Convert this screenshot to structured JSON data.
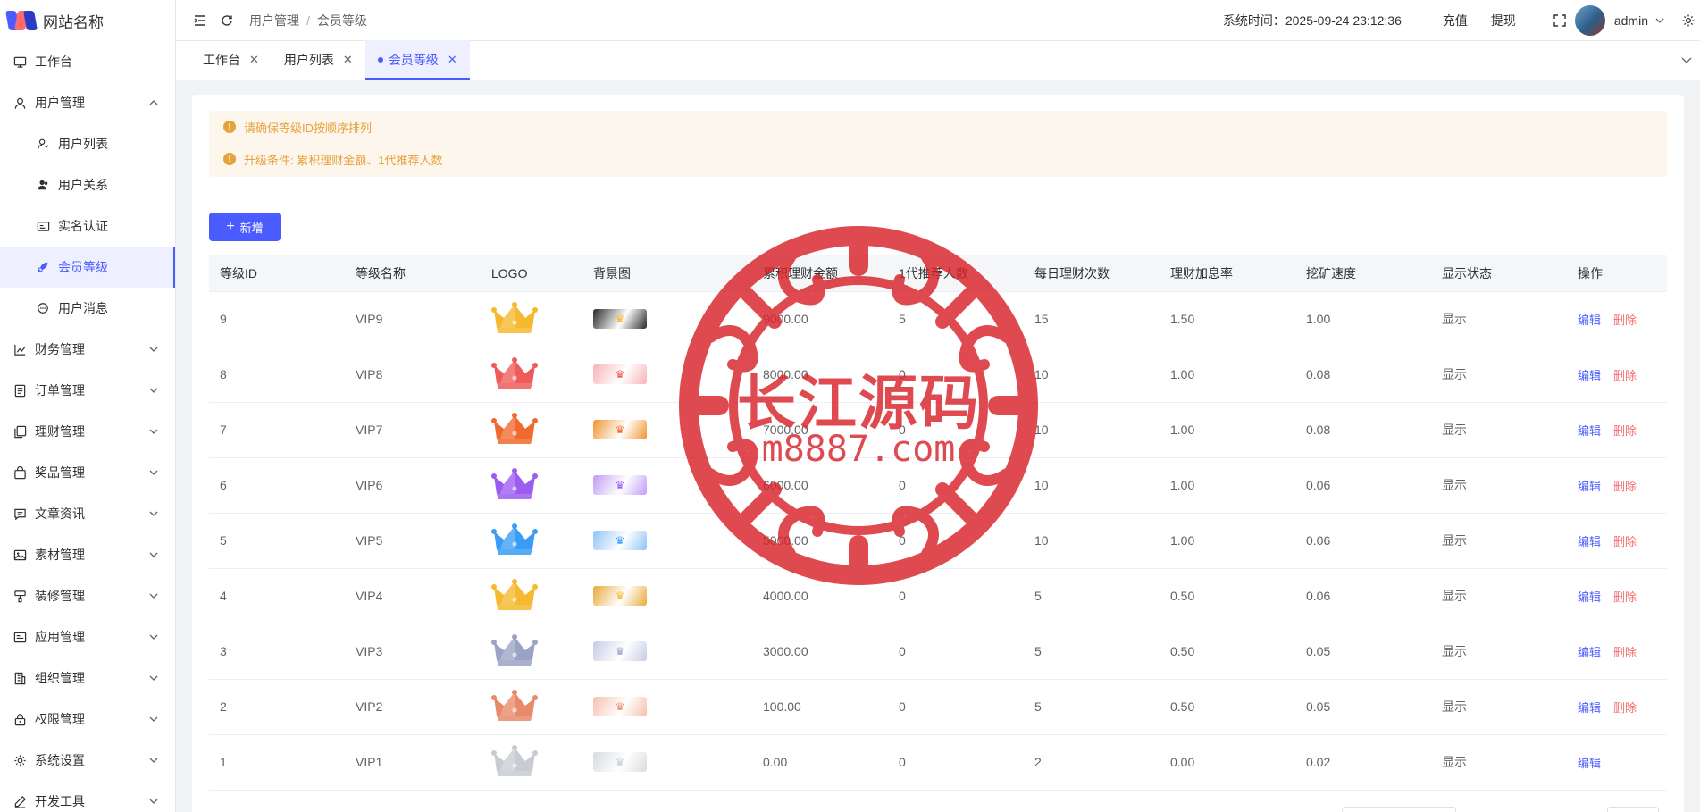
{
  "brand": {
    "name": "网站名称"
  },
  "sidebar": {
    "items": [
      {
        "label": "工作台",
        "icon": "monitor-icon"
      },
      {
        "label": "用户管理",
        "icon": "user-icon",
        "expanded": true,
        "children": [
          {
            "label": "用户列表",
            "icon": "user-outline-icon"
          },
          {
            "label": "用户关系",
            "icon": "user-filled-icon"
          },
          {
            "label": "实名认证",
            "icon": "id-card-icon"
          },
          {
            "label": "会员等级",
            "icon": "rocket-icon",
            "active": true
          },
          {
            "label": "用户消息",
            "icon": "chat-icon"
          }
        ]
      },
      {
        "label": "财务管理",
        "icon": "chart-icon"
      },
      {
        "label": "订单管理",
        "icon": "document-icon"
      },
      {
        "label": "理财管理",
        "icon": "copy-icon"
      },
      {
        "label": "奖品管理",
        "icon": "bag-icon"
      },
      {
        "label": "文章资讯",
        "icon": "message-icon"
      },
      {
        "label": "素材管理",
        "icon": "picture-icon"
      },
      {
        "label": "装修管理",
        "icon": "brush-icon"
      },
      {
        "label": "应用管理",
        "icon": "app-icon"
      },
      {
        "label": "组织管理",
        "icon": "building-icon"
      },
      {
        "label": "权限管理",
        "icon": "lock-icon"
      },
      {
        "label": "系统设置",
        "icon": "gear-icon"
      },
      {
        "label": "开发工具",
        "icon": "pen-icon"
      }
    ]
  },
  "header": {
    "breadcrumb": [
      "用户管理",
      "会员等级"
    ],
    "system_time": "系统时间：2025-09-24 23:12:36",
    "recharge": "充值",
    "withdraw": "提现",
    "user": "admin"
  },
  "tabs": [
    {
      "label": "工作台"
    },
    {
      "label": "用户列表"
    },
    {
      "label": "会员等级",
      "active": true
    }
  ],
  "alerts": [
    "请确保等级ID按顺序排列",
    "升级条件: 累积理财金额、1代推荐人数"
  ],
  "toolbar": {
    "add_label": "新增"
  },
  "table": {
    "columns": [
      "等级ID",
      "等级名称",
      "LOGO",
      "背景图",
      "累积理财金额",
      "1代推荐人数",
      "每日理财次数",
      "理财加息率",
      "挖矿速度",
      "显示状态",
      "操作"
    ],
    "edit_label": "编辑",
    "delete_label": "删除",
    "rows": [
      {
        "id": "9",
        "name": "VIP9",
        "amount": "9000.00",
        "referrals": "5",
        "daily": "15",
        "rate": "1.50",
        "speed": "1.00",
        "status": "显示",
        "crown_color": "#f5b82e",
        "bg_color": "#2a2a2a",
        "deletable": true
      },
      {
        "id": "8",
        "name": "VIP8",
        "amount": "8000.00",
        "referrals": "0",
        "daily": "10",
        "rate": "1.00",
        "speed": "0.08",
        "status": "显示",
        "crown_color": "#ef5a5a",
        "bg_color": "#f7b3b8",
        "deletable": true
      },
      {
        "id": "7",
        "name": "VIP7",
        "amount": "7000.00",
        "referrals": "0",
        "daily": "10",
        "rate": "1.00",
        "speed": "0.08",
        "status": "显示",
        "crown_color": "#f06a2e",
        "bg_color": "#f0942f",
        "deletable": true
      },
      {
        "id": "6",
        "name": "VIP6",
        "amount": "6000.00",
        "referrals": "0",
        "daily": "10",
        "rate": "1.00",
        "speed": "0.06",
        "status": "显示",
        "crown_color": "#9b5cf0",
        "bg_color": "#c19cf5",
        "deletable": true
      },
      {
        "id": "5",
        "name": "VIP5",
        "amount": "5000.00",
        "referrals": "0",
        "daily": "10",
        "rate": "1.00",
        "speed": "0.06",
        "status": "显示",
        "crown_color": "#3a9df5",
        "bg_color": "#8fc2f7",
        "deletable": true
      },
      {
        "id": "4",
        "name": "VIP4",
        "amount": "4000.00",
        "referrals": "0",
        "daily": "5",
        "rate": "0.50",
        "speed": "0.06",
        "status": "显示",
        "crown_color": "#f5b82e",
        "bg_color": "#e9a93a",
        "deletable": true
      },
      {
        "id": "3",
        "name": "VIP3",
        "amount": "3000.00",
        "referrals": "0",
        "daily": "5",
        "rate": "0.50",
        "speed": "0.05",
        "status": "显示",
        "crown_color": "#9aa3c4",
        "bg_color": "#c5cbe6",
        "deletable": true
      },
      {
        "id": "2",
        "name": "VIP2",
        "amount": "100.00",
        "referrals": "0",
        "daily": "5",
        "rate": "0.50",
        "speed": "0.05",
        "status": "显示",
        "crown_color": "#e88a6a",
        "bg_color": "#f6c0ae",
        "deletable": true
      },
      {
        "id": "1",
        "name": "VIP1",
        "amount": "0.00",
        "referrals": "0",
        "daily": "2",
        "rate": "0.00",
        "speed": "0.02",
        "status": "显示",
        "crown_color": "#c8ccd2",
        "bg_color": "#d8dbe0",
        "deletable": false
      }
    ]
  },
  "watermark": {
    "title": "长江源码",
    "url": "m8887.com",
    "color": "#d8232a"
  },
  "colors": {
    "primary": "#4a5cff",
    "danger": "#f56c6c",
    "warning": "#e6a23c"
  }
}
